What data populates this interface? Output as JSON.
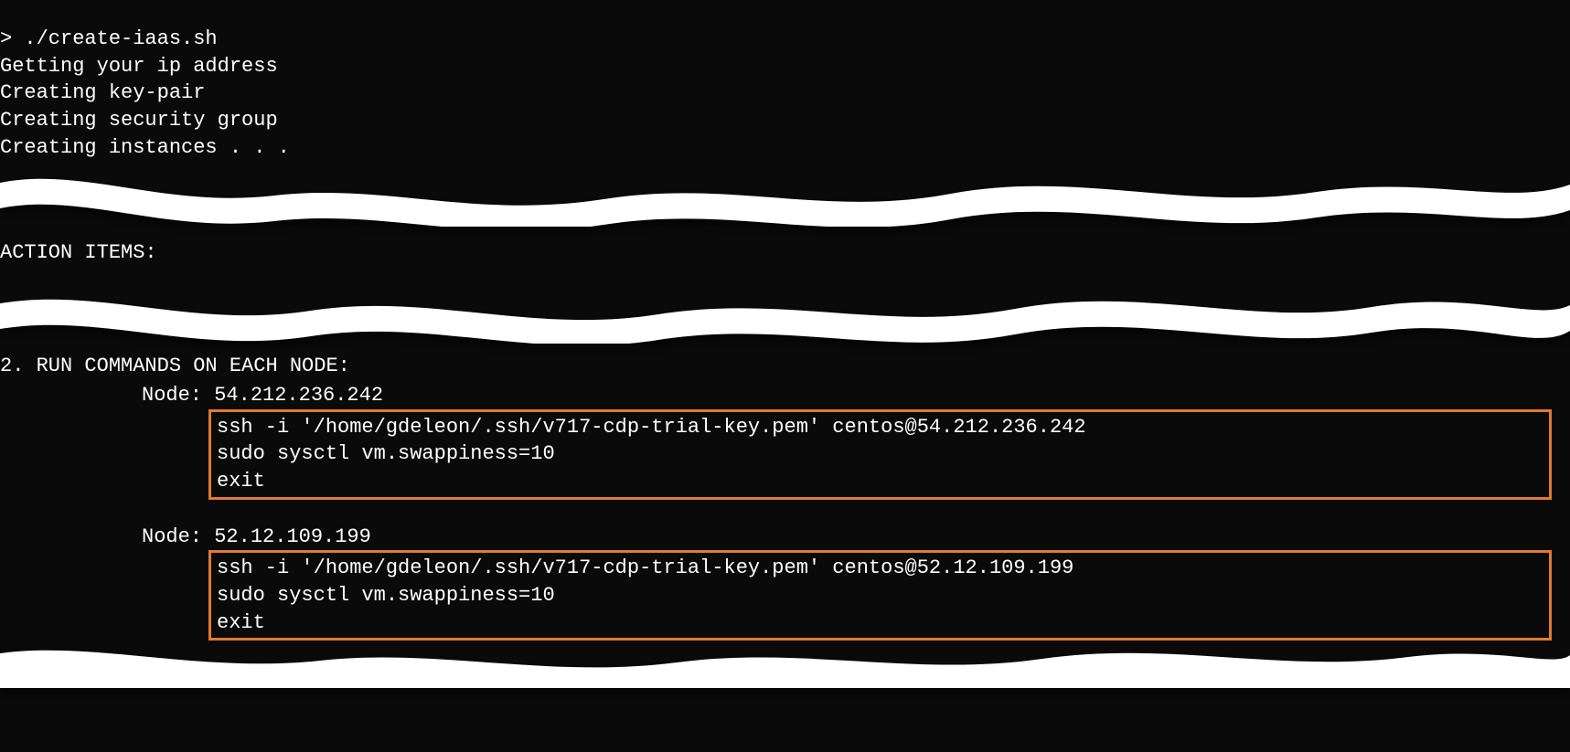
{
  "top": {
    "lines": [
      "> ./create-iaas.sh",
      "Getting your ip address",
      "Creating key-pair",
      "Creating security group",
      "Creating instances . . ."
    ]
  },
  "mid": {
    "heading": "ACTION ITEMS:"
  },
  "bottom": {
    "heading": "2. RUN COMMANDS ON EACH NODE:",
    "nodes": [
      {
        "label": "Node: 54.212.236.242",
        "cmds": [
          "ssh -i '/home/gdeleon/.ssh/v717-cdp-trial-key.pem' centos@54.212.236.242",
          "sudo sysctl vm.swappiness=10",
          "exit"
        ]
      },
      {
        "label": "Node: 52.12.109.199",
        "cmds": [
          "ssh -i '/home/gdeleon/.ssh/v717-cdp-trial-key.pem' centos@52.12.109.199",
          "sudo sysctl vm.swappiness=10",
          "exit"
        ]
      }
    ]
  },
  "colors": {
    "highlight_border": "#e07b2f"
  }
}
